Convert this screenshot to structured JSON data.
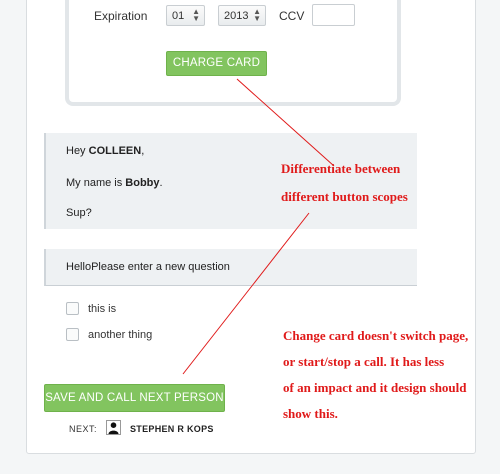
{
  "payment": {
    "expiration_label": "Expiration",
    "month_value": "01",
    "year_value": "2013",
    "ccv_label": "CCV",
    "ccv_value": "",
    "charge_button": "CHARGE CARD"
  },
  "chat": {
    "greeting_prefix": "Hey ",
    "greeting_name": "COLLEEN",
    "greeting_suffix": ",",
    "intro_prefix": "My name is ",
    "intro_name": "Bobby",
    "intro_suffix": ".",
    "closing": "Sup?"
  },
  "question": {
    "text": "HelloPlease enter a new question"
  },
  "options": [
    {
      "label": "this is",
      "checked": false
    },
    {
      "label": "another thing",
      "checked": false
    }
  ],
  "actions": {
    "save_call_button": "SAVE AND CALL NEXT PERSON",
    "next_label": "NEXT:",
    "next_person": "STEPHEN R KOPS"
  },
  "annotations": {
    "note1_line1": "Differentiate between",
    "note1_line2": "different button scopes",
    "note2_line1": "Change card doesn't switch page,",
    "note2_line2": "or start/stop a call. It has less",
    "note2_line3": "of an impact and it design should",
    "note2_line4": "show this.",
    "color": "#e01a1a"
  },
  "colors": {
    "primary_button": "#82c45f",
    "panel_background": "#ffffff",
    "message_background": "#eef1f3"
  }
}
